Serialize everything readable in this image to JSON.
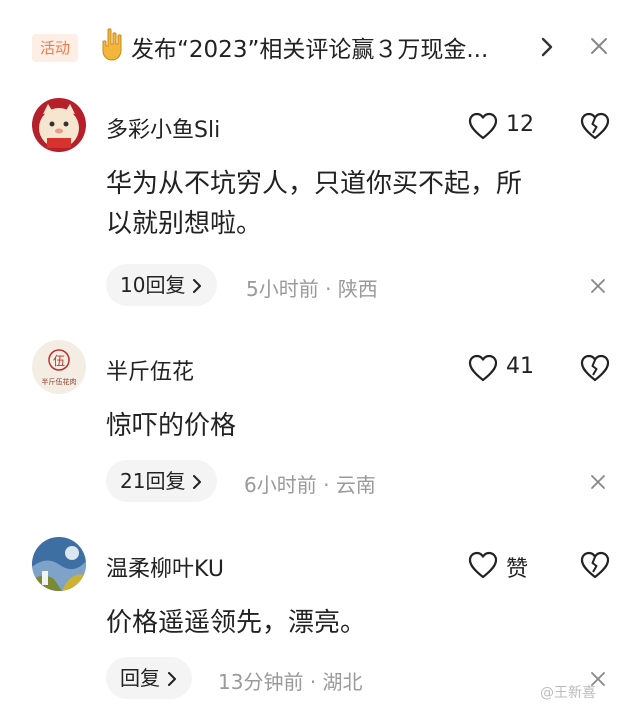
{
  "banner": {
    "tag": "活动",
    "text": "发布“2023”相关评论赢３万现金..."
  },
  "comments": [
    {
      "username": "多彩小鱼Sli",
      "likes": "12",
      "text_line1": "华为从不坑穷人，只道你买不起，所",
      "text_line2": "以就别想啦。",
      "reply_label": "10回复",
      "time": "5小时前",
      "location": "陕西"
    },
    {
      "username": "半斤伍花",
      "avatar_text_top": "伍",
      "avatar_text_bottom": "半斤伍花肉",
      "likes": "41",
      "text_line1": "惊吓的价格",
      "reply_label": "21回复",
      "time": "6小时前",
      "location": "云南"
    },
    {
      "username": "温柔柳叶KU",
      "likes": "赞",
      "text_line1": "价格遥遥领先，漂亮。",
      "reply_label": "回复",
      "time": "13分钟前",
      "location": "湖北"
    }
  ],
  "meta_separator": "·",
  "watermark": "@王新喜",
  "colors": {
    "activity_tag_bg": "#fdeee6",
    "activity_tag_text": "#ef7a4b",
    "meta_text": "#9a9a9a",
    "reply_bg": "#f4f4f4"
  }
}
